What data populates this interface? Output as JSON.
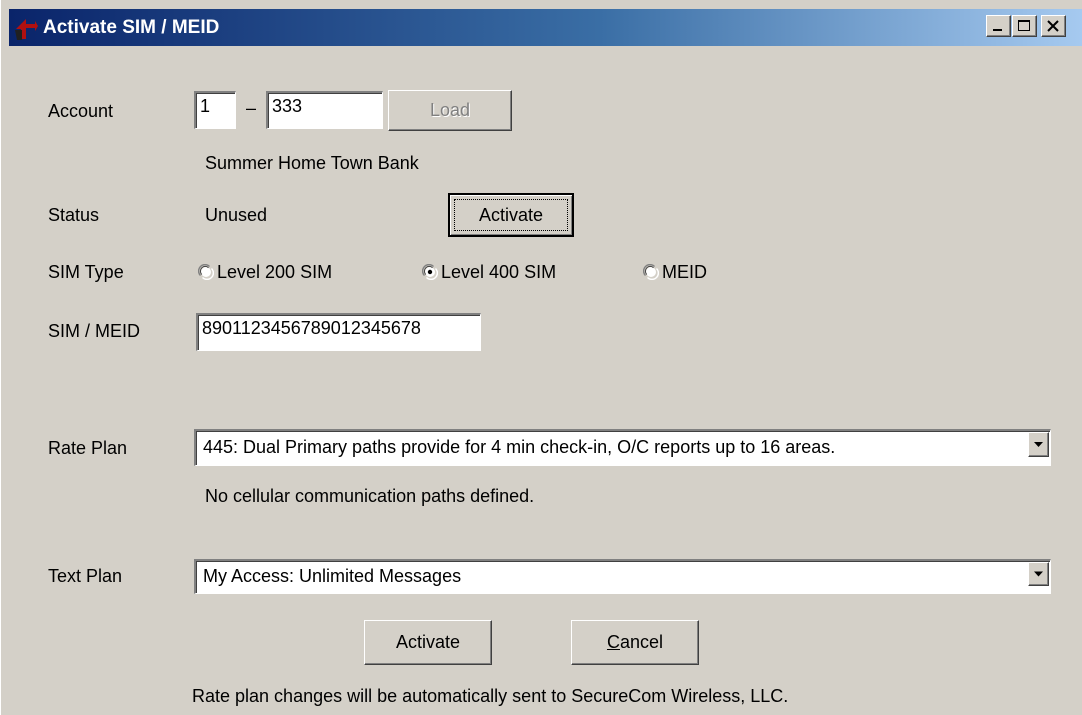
{
  "window": {
    "title": "Activate SIM / MEID"
  },
  "account": {
    "label": "Account",
    "prefix_value": "1",
    "separator": "–",
    "number_value": "333",
    "load_label": "Load",
    "name": "Summer Home Town Bank"
  },
  "status": {
    "label": "Status",
    "value": "Unused",
    "activate_label": "Activate"
  },
  "sim_type": {
    "label": "SIM Type",
    "options": [
      {
        "label": "Level 200 SIM",
        "selected": false
      },
      {
        "label": "Level 400 SIM",
        "selected": true
      },
      {
        "label": "MEID",
        "selected": false
      }
    ]
  },
  "sim_meid": {
    "label": "SIM / MEID",
    "value": "8901123456789012345678"
  },
  "rate_plan": {
    "label": "Rate Plan",
    "selected": "445: Dual Primary paths provide for 4 min check-in, O/C reports up to 16 areas.",
    "note": "No cellular communication paths defined."
  },
  "text_plan": {
    "label": "Text Plan",
    "selected": "My Access: Unlimited Messages"
  },
  "footer": {
    "activate_label": "Activate",
    "cancel_label_first": "C",
    "cancel_label_rest": "ancel",
    "notice": "Rate plan changes will be automatically sent to SecureCom Wireless, LLC."
  },
  "icons": {
    "app": "app-logo-icon",
    "minimize": "minimize-icon",
    "maximize": "maximize-icon",
    "close": "close-icon",
    "dropdown": "chevron-down-icon"
  },
  "colors": {
    "titlebar_start": "#0a246a",
    "titlebar_end": "#a6caf0",
    "face": "#d4d0c8"
  }
}
